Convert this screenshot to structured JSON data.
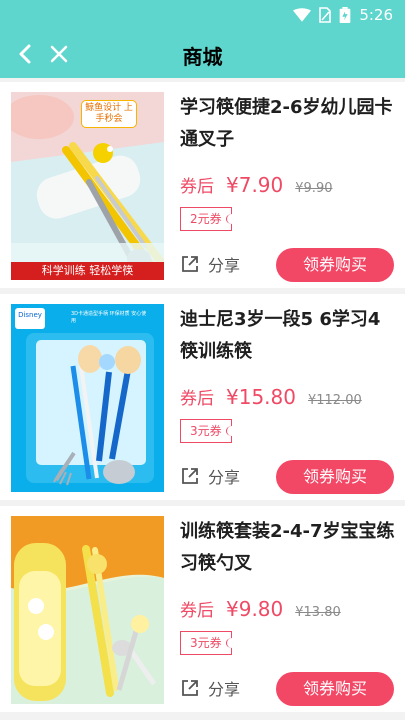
{
  "status_bar": {
    "time": "5:26"
  },
  "nav": {
    "title": "商城"
  },
  "products": [
    {
      "name": "学习筷便捷2-6岁幼儿园卡通叉子",
      "price_label": "券后",
      "price": "¥7.90",
      "original_price": "¥9.90",
      "coupon": "2元券",
      "share_label": "分享",
      "buy_label": "领券购买",
      "image_texts": {
        "tag": "鲸鱼设计 上手秒会",
        "bottom": "科学训练 轻松学筷"
      }
    },
    {
      "name": "迪士尼3岁一段5 6学习4筷训练筷",
      "price_label": "券后",
      "price": "¥15.80",
      "original_price": "¥112.00",
      "coupon": "3元券",
      "share_label": "分享",
      "buy_label": "领券购买",
      "image_texts": {
        "brand": "Disney",
        "top": "3D卡通造型手柄 环保材质 安心使用"
      }
    },
    {
      "name": "训练筷套装2-4-7岁宝宝练习筷勺叉",
      "price_label": "券后",
      "price": "¥9.80",
      "original_price": "¥13.80",
      "coupon": "3元券",
      "share_label": "分享",
      "buy_label": "领券购买",
      "image_texts": {}
    }
  ],
  "colors": {
    "header": "#5fd6cd",
    "accent": "#f34766",
    "price": "#ef4a65"
  },
  "icons": {
    "back": "chevron-left-icon",
    "close": "close-icon",
    "share": "share-icon",
    "wifi": "wifi-icon",
    "sim": "sim-icon",
    "battery": "battery-icon"
  }
}
